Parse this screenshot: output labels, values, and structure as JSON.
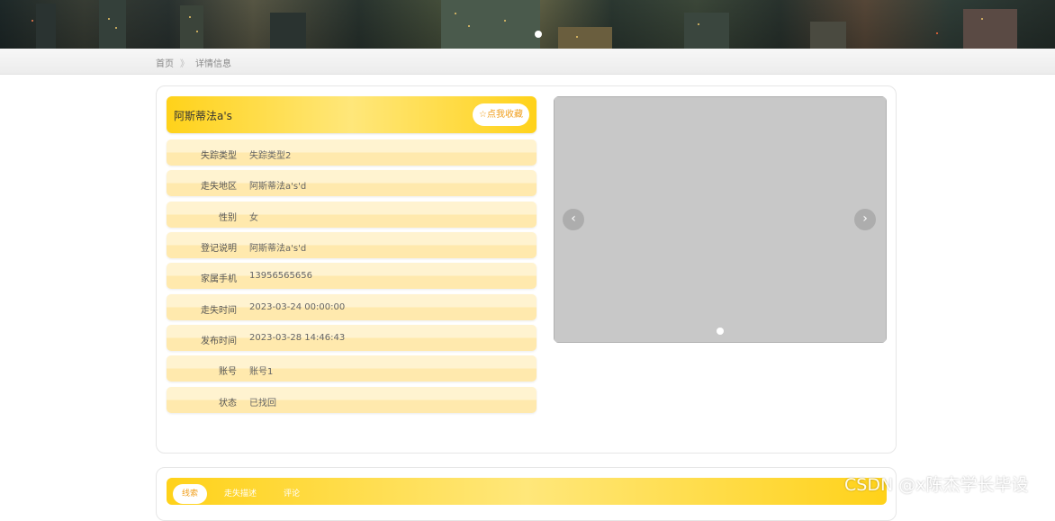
{
  "breadcrumb": {
    "home": "首页",
    "separator": "》",
    "current": "详情信息"
  },
  "detail": {
    "title": "阿斯蒂法a's",
    "favorite_label": "☆点我收藏",
    "fields": [
      {
        "label": "失踪类型",
        "value": "失踪类型2"
      },
      {
        "label": "走失地区",
        "value": "阿斯蒂法a's'd"
      },
      {
        "label": "性别",
        "value": "女"
      },
      {
        "label": "登记说明",
        "value": "阿斯蒂法a's'd"
      },
      {
        "label": "家属手机",
        "value": "13956565656"
      },
      {
        "label": "走失时间",
        "value": "2023-03-24 00:00:00"
      },
      {
        "label": "发布时间",
        "value": "2023-03-28 14:46:43"
      },
      {
        "label": "账号",
        "value": "账号1"
      },
      {
        "label": "状态",
        "value": "已找回"
      }
    ]
  },
  "carousel": {
    "prev": "‹",
    "next": "›"
  },
  "tabs": [
    {
      "label": "线索",
      "active": true
    },
    {
      "label": "走失描述",
      "active": false
    },
    {
      "label": "评论",
      "active": false
    }
  ],
  "watermark": "CSDN @x陈杰学长毕设",
  "colors": {
    "accent": "#ffd21a",
    "accent_text": "#f0a020",
    "row_bg": "#fff3d0"
  }
}
